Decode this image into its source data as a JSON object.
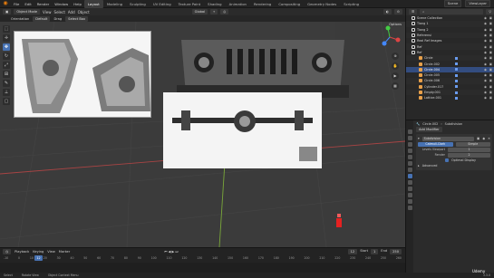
{
  "app": {
    "menus": [
      "File",
      "Edit",
      "Render",
      "Window",
      "Help"
    ],
    "workspaces": [
      "Layout",
      "Modeling",
      "Sculpting",
      "UV Editing",
      "Texture Paint",
      "Shading",
      "Animation",
      "Rendering",
      "Compositing",
      "Geometry Nodes",
      "Scripting"
    ],
    "active_workspace": "Layout",
    "scene": "Scene",
    "view_layer": "ViewLayer"
  },
  "viewport_header": {
    "mode": "Object Mode",
    "menus": [
      "View",
      "Select",
      "Add",
      "Object"
    ],
    "transform": "Global",
    "orientation_label": "Orientation",
    "orientation_value": "Default",
    "drag_label": "Drag",
    "drag_value": "Select Box",
    "options": "Options"
  },
  "toolbar": {
    "tools": [
      "select",
      "cursor",
      "move",
      "rotate",
      "scale",
      "transform",
      "annotate",
      "measure",
      "add-cube"
    ],
    "active_index": 2
  },
  "outliner": {
    "items": [
      {
        "label": "Scene Collection",
        "type": "collection"
      },
      {
        "label": "Tiang 1",
        "type": "collection"
      },
      {
        "label": "Tiang 2",
        "type": "collection"
      },
      {
        "label": "Referensi",
        "type": "collection"
      },
      {
        "label": "Real Ref Images",
        "type": "collection"
      },
      {
        "label": "Ref",
        "type": "collection"
      },
      {
        "label": "Ref",
        "type": "collection"
      },
      {
        "label": "Circle",
        "type": "object"
      },
      {
        "label": "Circle.002",
        "type": "object"
      },
      {
        "label": "Circle.004",
        "type": "object"
      },
      {
        "label": "Circle.005",
        "type": "object"
      },
      {
        "label": "Circle.006",
        "type": "object"
      },
      {
        "label": "Cylinder.017",
        "type": "object"
      },
      {
        "label": "Empty.001",
        "type": "object"
      },
      {
        "label": "Lattice.001",
        "type": "object"
      }
    ],
    "selected_index": 9
  },
  "properties": {
    "object": "Circle.002",
    "modifier": "Subdivision",
    "add_modifier": "Add Modifier",
    "modifier_name": "Subdivision",
    "mode_options": [
      "Catmull-Clark",
      "Simple"
    ],
    "active_mode": "Catmull-Clark",
    "levels_viewport_label": "Levels Viewport",
    "levels_viewport": "1",
    "render_label": "Render",
    "render": "2",
    "optimal_display": "Optimal Display",
    "advanced": "Advanced"
  },
  "timeline": {
    "menus": [
      "Playback",
      "Keying",
      "View",
      "Marker"
    ],
    "current_frame": "12",
    "start_label": "Start",
    "start": "1",
    "end_label": "End",
    "end": "250",
    "ruler": [
      "-10",
      "0",
      "10",
      "20",
      "30",
      "40",
      "50",
      "60",
      "70",
      "80",
      "90",
      "100",
      "110",
      "120",
      "130",
      "140",
      "150",
      "160",
      "170",
      "180",
      "190",
      "200",
      "210",
      "220",
      "230",
      "240",
      "250",
      "260"
    ]
  },
  "statusbar": {
    "items": [
      "Select",
      "Rotate View",
      "Object Context Menu"
    ],
    "version": "3.3.0"
  },
  "watermark": "Udemy",
  "colors": {
    "accent": "#4772b3",
    "brand": "#e87d0d",
    "cursor": "#e52121"
  }
}
